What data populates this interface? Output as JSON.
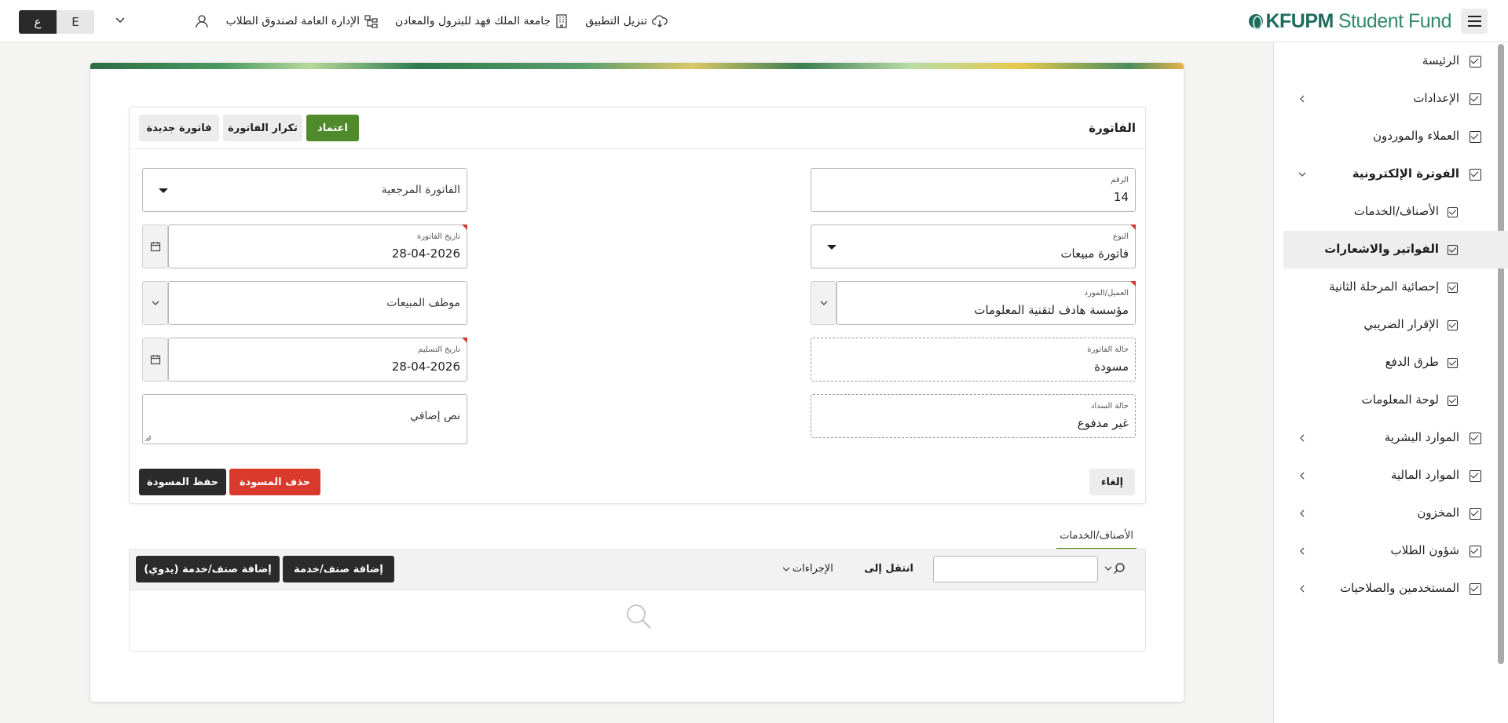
{
  "header": {
    "brand_primary": "KFUPM",
    "brand_secondary": "Student Fund",
    "links": [
      {
        "label": "تنزيل التطبيق",
        "icon": "cloud-download-icon"
      },
      {
        "label": "جامعة الملك فهد للبترول والمعادن",
        "icon": "building-icon"
      },
      {
        "label": "الإدارة العامة لصندوق الطلاب",
        "icon": "org-chart-icon"
      }
    ],
    "lang_ar": "ع",
    "lang_en": "E"
  },
  "sidebar": {
    "items": [
      {
        "label": "الرئيسة",
        "has_arrow": false
      },
      {
        "label": "الإعدادات",
        "has_arrow": true
      },
      {
        "label": "العملاء والموردون",
        "has_arrow": false
      },
      {
        "label": "الفوترة الإلكترونية",
        "has_arrow": true,
        "expanded": true
      },
      {
        "label": "الأصناف/الخدمات",
        "sub": true
      },
      {
        "label": "الفواتير والاشعارات",
        "sub": true,
        "active": true
      },
      {
        "label": "إحصائية المرحلة الثانية",
        "sub": true
      },
      {
        "label": "الإقرار الضريبي",
        "sub": true
      },
      {
        "label": "طرق الدفع",
        "sub": true
      },
      {
        "label": "لوحة المعلومات",
        "sub": true
      },
      {
        "label": "الموارد البشرية",
        "has_arrow": true
      },
      {
        "label": "الموارد المالية",
        "has_arrow": true
      },
      {
        "label": "المخزون",
        "has_arrow": true
      },
      {
        "label": "شؤون الطلاب",
        "has_arrow": true
      },
      {
        "label": "المستخدمين والصلاحيات",
        "has_arrow": true
      }
    ]
  },
  "invoice": {
    "title": "الفاتورة",
    "buttons": {
      "approve": "اعتماد",
      "duplicate": "تكرار الفاتورة",
      "new": "فاتورة جديدة",
      "cancel": "إلغاء",
      "delete_draft": "حذف المسودة",
      "save_draft": "حفظ المسودة"
    },
    "fields": {
      "number": {
        "label": "الرقم",
        "value": "14"
      },
      "type": {
        "label": "النوع",
        "value": "فاتورة مبيعات"
      },
      "customer": {
        "label": "العميل/المورد",
        "value": "مؤسسة هادف لتقنية المعلومات"
      },
      "invoice_status": {
        "label": "حالة الفاتورة",
        "value": "مسودة"
      },
      "payment_status": {
        "label": "حالة السداد",
        "value": "غير مدفوع"
      },
      "reference_invoice": {
        "placeholder": "الفاتورة المرجعية"
      },
      "invoice_date": {
        "label": "تاريخ الفاتورة",
        "value": "28-04-2026"
      },
      "sales_employee": {
        "placeholder": "موظف المبيعات"
      },
      "delivery_date": {
        "label": "تاريخ التسليم",
        "value": "28-04-2026"
      },
      "additional_text": {
        "placeholder": "نص إضافي"
      }
    }
  },
  "items": {
    "tab_label": "الأصناف/الخدمات",
    "goto_label": "انتقل إلى",
    "actions_label": "الإجراءات",
    "add_item": "إضافة صنف/خدمة",
    "add_item_manual": "إضافة صنف/خدمة (يدوي)",
    "search_value": ""
  },
  "colors": {
    "accent_green": "#4f8a2b",
    "danger_red": "#d93a2b",
    "brand_teal": "#1e6b5b",
    "dark_button": "#2b2b2b"
  }
}
